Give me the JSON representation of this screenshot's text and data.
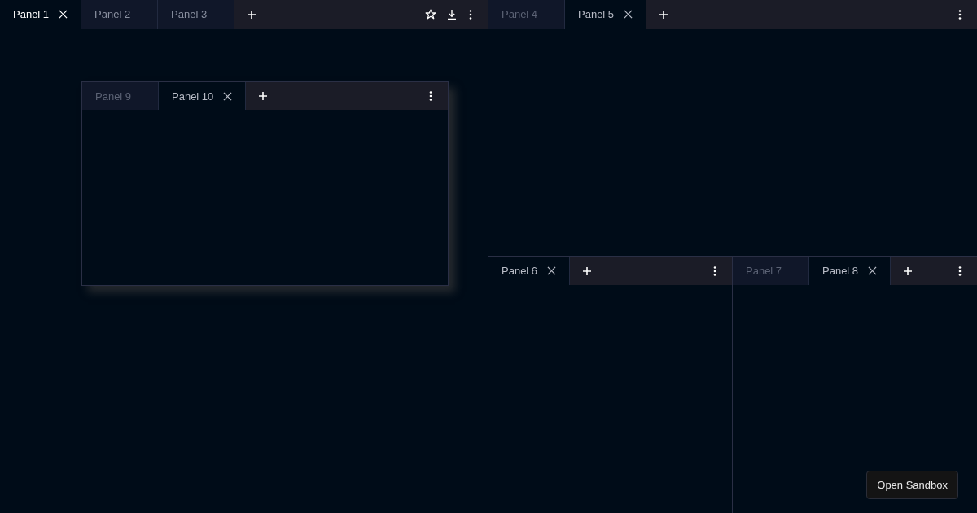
{
  "groups": [
    {
      "active": true,
      "tabs": [
        {
          "label": "Panel 1",
          "selected": true
        },
        {
          "label": "Panel 2",
          "selected": false
        },
        {
          "label": "Panel 3",
          "selected": false
        }
      ],
      "actions": [
        {
          "kind": "star"
        },
        {
          "kind": "download"
        },
        {
          "kind": "more"
        }
      ]
    },
    {
      "active": false,
      "tabs": [
        {
          "label": "Panel 4",
          "selected": false
        },
        {
          "label": "Panel 5",
          "selected": true
        }
      ],
      "actions": [
        {
          "kind": "more"
        }
      ]
    },
    {
      "active": false,
      "tabs": [
        {
          "label": "Panel 6",
          "selected": true
        }
      ],
      "actions": [
        {
          "kind": "more"
        }
      ]
    },
    {
      "active": false,
      "tabs": [
        {
          "label": "Panel 7",
          "selected": false
        },
        {
          "label": "Panel 8",
          "selected": true
        }
      ],
      "actions": [
        {
          "kind": "more"
        }
      ]
    },
    {
      "active": false,
      "tabs": [
        {
          "label": "Panel 9",
          "selected": false
        },
        {
          "label": "Panel 10",
          "selected": true
        }
      ],
      "actions": [
        {
          "kind": "more"
        }
      ]
    }
  ],
  "sandbox_button": "Open Sandbox"
}
